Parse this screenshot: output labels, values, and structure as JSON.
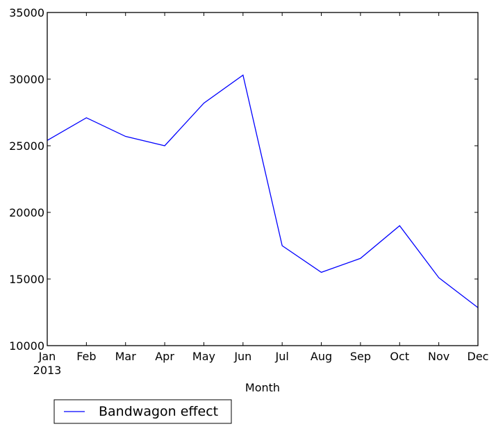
{
  "chart_data": {
    "type": "line",
    "title": "",
    "xlabel": "Month",
    "ylabel": "",
    "x": [
      "Jan",
      "Feb",
      "Mar",
      "Apr",
      "May",
      "Jun",
      "Jul",
      "Aug",
      "Sep",
      "Oct",
      "Nov",
      "Dec"
    ],
    "x_sublabel": "2013",
    "ylim": [
      10000,
      35000
    ],
    "yticks": [
      10000,
      15000,
      20000,
      25000,
      30000,
      35000
    ],
    "ytick_labels": [
      "10000",
      "15000",
      "20000",
      "25000",
      "30000",
      "35000"
    ],
    "grid": false,
    "legend_position": "below-left",
    "series": [
      {
        "name": "Bandwagon effect",
        "color": "#0000ff",
        "values": [
          25400,
          27100,
          25700,
          25000,
          28200,
          30300,
          17500,
          15500,
          16550,
          19000,
          15100,
          12850
        ]
      }
    ]
  }
}
